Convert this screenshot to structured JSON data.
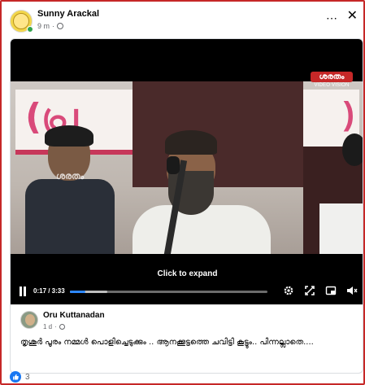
{
  "post": {
    "author": "Sunny Arackal",
    "time": "9 m",
    "separator": "·",
    "more_icon": "⋯",
    "close_icon": "✕"
  },
  "video": {
    "channel_logo": "ശരതം",
    "channel_tag": "VIDEO VISION",
    "watermark": "ശരതം",
    "expand_label": "Click to expand",
    "time": "0:17 / 3:33",
    "progress": 0.08,
    "buffered": 0.19
  },
  "shared": {
    "author": "Oru Kuttanadan",
    "time": "1 d",
    "separator": "·",
    "text": "തൃശൂർ പൂരം നമ്മൾ പൊളിച്ചെടുക്കും .. ആനക്കൂട്ടത്തെ ചവിട്ടി കൂട്ടും.. പിന്നല്ലാതെ...."
  },
  "reactions": {
    "count": "3",
    "icon": "like-icon"
  },
  "colors": {
    "accent": "#1877f2",
    "border": "#c62828"
  }
}
